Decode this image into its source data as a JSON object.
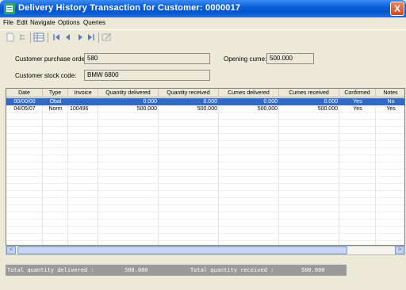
{
  "window": {
    "title": "Delivery History Transaction for Customer: 0000017",
    "close_label": "X"
  },
  "menu": {
    "items": [
      "File",
      "Edit",
      "Navigate",
      "Options",
      "Queries"
    ]
  },
  "toolbar": {
    "icons": [
      "new-icon",
      "tree-icon",
      "grid-icon",
      "first-icon",
      "prev-icon",
      "next-icon",
      "last-icon",
      "edit-icon"
    ]
  },
  "form": {
    "customer_po_label": "Customer purchase order:",
    "customer_po_value": "580",
    "opening_cume_label": "Opening cume:",
    "opening_cume_value": "500.000",
    "customer_stock_label": "Customer stock code:",
    "customer_stock_value": "BMW 6800"
  },
  "grid": {
    "columns": [
      "Date",
      "Type",
      "Invoice",
      "Quantity delivered",
      "Quantity received",
      "Cumes delivered",
      "Cumes received",
      "Confirmed",
      "Notes"
    ],
    "rows": [
      [
        "00/00/00",
        "Obal",
        "",
        "0.000",
        "0.000",
        "0.000",
        "0.000",
        "Yes",
        "No"
      ],
      [
        "04/05/07",
        "Norm",
        "100496",
        "500.000",
        "500.000",
        "500.000",
        "500.000",
        "Yes",
        "Yes"
      ]
    ],
    "selected_row": 0
  },
  "scrollbar": {
    "left_arrow": "<",
    "right_arrow": ">"
  },
  "totals": {
    "delivered_label": "Total quantity delivered :",
    "delivered_value": "500.000",
    "received_label": "Total quantity received :",
    "received_value": "500.000"
  },
  "colors": {
    "title_bar": "#0a5fd8",
    "selection": "#316ac5",
    "totals_bar": "#9a9a9a"
  }
}
